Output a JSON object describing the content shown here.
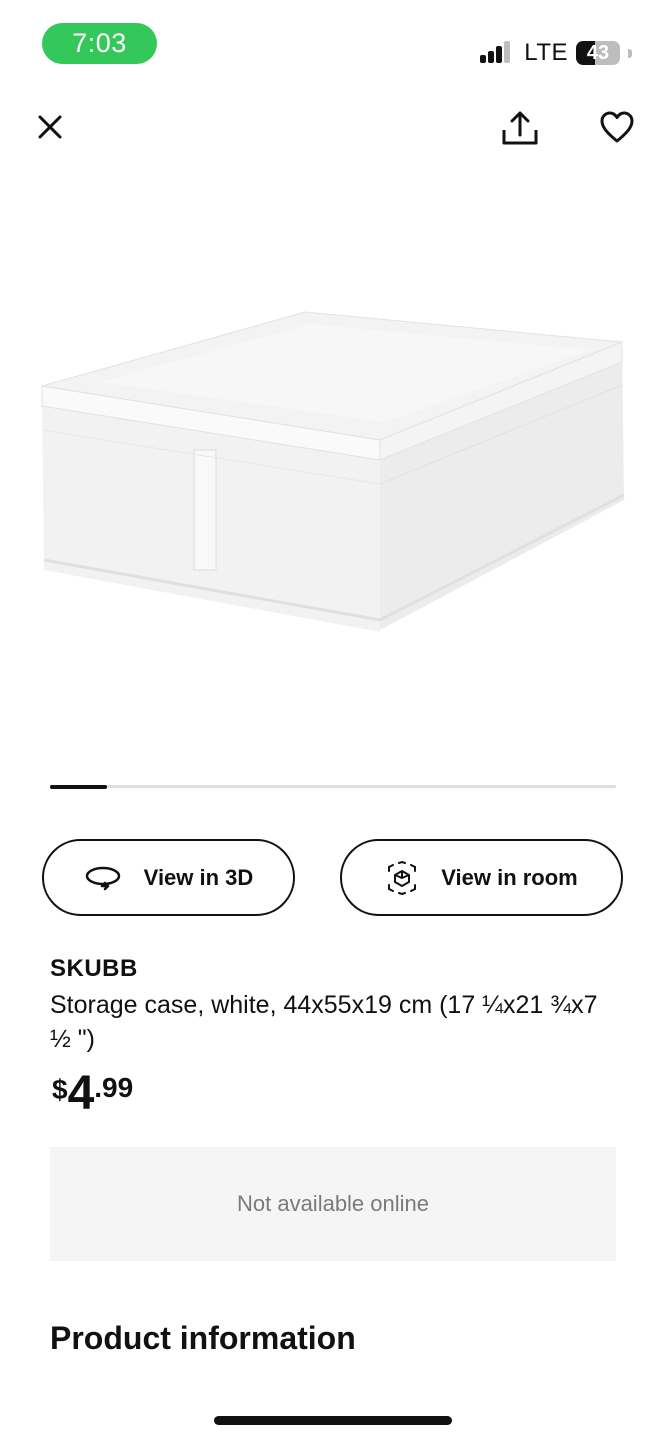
{
  "status_bar": {
    "time": "7:03",
    "network": "LTE",
    "battery_level": "43",
    "time_pill_color": "#34c759"
  },
  "toolbar": {
    "close_icon": "close-icon",
    "share_icon": "share-icon",
    "favorite_icon": "heart-icon"
  },
  "gallery": {
    "image_subject": "white fabric storage case",
    "progress": 0.1
  },
  "actions": {
    "view_3d_label": "View in 3D",
    "view_3d_icon": "rotate-3d-icon",
    "view_room_label": "View in room",
    "view_room_icon": "ar-cube-icon"
  },
  "product": {
    "name": "SKUBB",
    "description": "Storage case, white, 44x55x19 cm (17 ¼x21 ¾x7 ½ \")",
    "price_currency": "$",
    "price_integer": "4",
    "price_decimal": ".99"
  },
  "availability": {
    "text": "Not available online"
  },
  "sections": {
    "product_information": "Product information"
  }
}
